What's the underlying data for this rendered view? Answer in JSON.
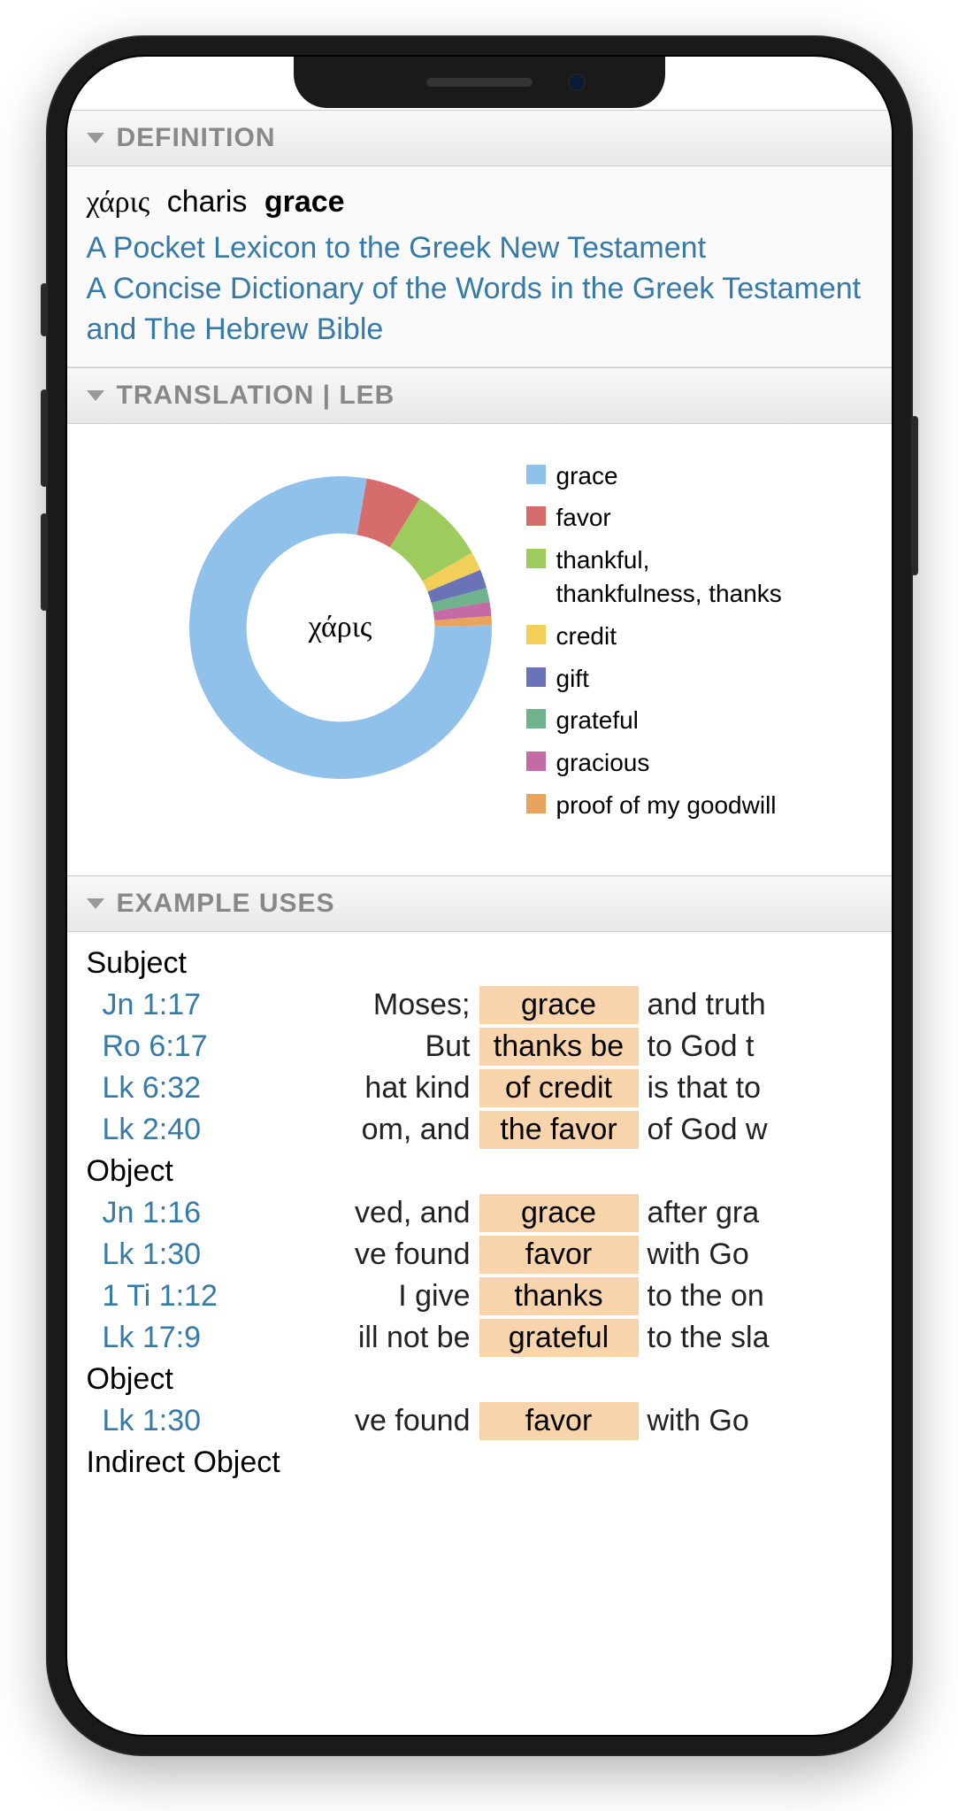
{
  "sections": {
    "definition_title": "DEFINITION",
    "translation_title": "TRANSLATION | LEB",
    "examples_title": "EXAMPLE USES"
  },
  "definition": {
    "greek": "χάρις",
    "transliteration": "charis",
    "gloss": "grace",
    "links": [
      "A Pocket Lexicon to the Greek New Testament",
      "A Concise Dictionary of the Words in the Greek Testament and The Hebrew Bible"
    ]
  },
  "chart_data": {
    "type": "pie",
    "center_label": "χάρις",
    "series": [
      {
        "name": "grace",
        "value": 78,
        "color": "#8fc1ea"
      },
      {
        "name": "favor",
        "value": 6,
        "color": "#d66c6c"
      },
      {
        "name": "thankful, thankfulness, thanks",
        "value": 8,
        "color": "#9ecb5d"
      },
      {
        "name": "credit",
        "value": 2,
        "color": "#f2cf58"
      },
      {
        "name": "gift",
        "value": 2,
        "color": "#6a73b8"
      },
      {
        "name": "grateful",
        "value": 1.5,
        "color": "#6fb38d"
      },
      {
        "name": "gracious",
        "value": 1.5,
        "color": "#c46aa5"
      },
      {
        "name": "proof of my goodwill",
        "value": 1,
        "color": "#e8a35d"
      }
    ]
  },
  "examples": {
    "groups": [
      {
        "label": "Subject",
        "rows": [
          {
            "ref": "Jn 1:17",
            "pre": "Moses;",
            "hl": "grace",
            "post": "and truth"
          },
          {
            "ref": "Ro 6:17",
            "pre": "But",
            "hl": "thanks be",
            "post": "to God t"
          },
          {
            "ref": "Lk 6:32",
            "pre": "hat kind",
            "hl": "of credit",
            "post": "is that to"
          },
          {
            "ref": "Lk 2:40",
            "pre": "om, and",
            "hl": "the favor",
            "post": "of God w"
          }
        ]
      },
      {
        "label": "Object",
        "rows": [
          {
            "ref": "Jn 1:16",
            "pre": "ved, and",
            "hl": "grace",
            "post": "after gra"
          },
          {
            "ref": "Lk 1:30",
            "pre": "ve found",
            "hl": "favor",
            "post": "with Go"
          },
          {
            "ref": "1 Ti 1:12",
            "pre": "I give",
            "hl": "thanks",
            "post": "to the on"
          },
          {
            "ref": "Lk 17:9",
            "pre": "ill not be",
            "hl": "grateful",
            "post": "to the sla"
          }
        ]
      },
      {
        "label": "Object",
        "rows": [
          {
            "ref": "Lk 1:30",
            "pre": "ve found",
            "hl": "favor",
            "post": "with Go"
          }
        ]
      },
      {
        "label": "Indirect Object",
        "rows": []
      }
    ]
  }
}
